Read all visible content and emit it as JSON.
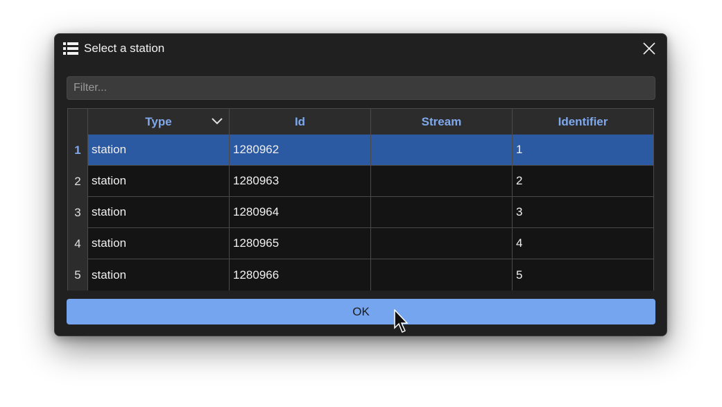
{
  "dialog": {
    "title": "Select a station",
    "title_icon": "list-icon",
    "close_icon": "close-icon"
  },
  "filter": {
    "placeholder": "Filter...",
    "value": ""
  },
  "table": {
    "columns": [
      "Type",
      "Id",
      "Stream",
      "Identifier"
    ],
    "sort_column": "Type",
    "sort_icon": "chevron-down-icon",
    "selected_row": 1,
    "rows": [
      {
        "num": "1",
        "type": "station",
        "id": "1280962",
        "stream": "",
        "identifier": "1"
      },
      {
        "num": "2",
        "type": "station",
        "id": "1280963",
        "stream": "",
        "identifier": "2"
      },
      {
        "num": "3",
        "type": "station",
        "id": "1280964",
        "stream": "",
        "identifier": "3"
      },
      {
        "num": "4",
        "type": "station",
        "id": "1280965",
        "stream": "",
        "identifier": "4"
      },
      {
        "num": "5",
        "type": "station",
        "id": "1280966",
        "stream": "",
        "identifier": "5"
      }
    ]
  },
  "ok_button": {
    "label": "OK"
  },
  "colors": {
    "accent": "#75a5ef",
    "selected_row": "#2b5aa3",
    "header_text": "#7fa9ec",
    "background": "#202020"
  }
}
